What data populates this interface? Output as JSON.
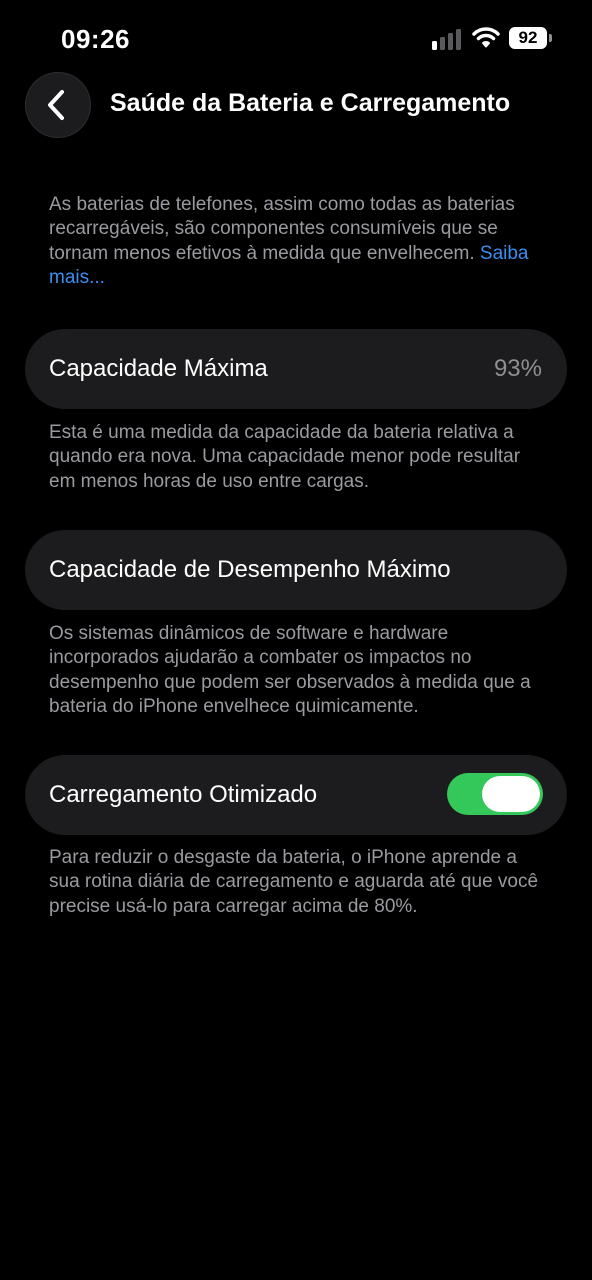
{
  "status_bar": {
    "time": "09:26",
    "battery_level": "92",
    "signal_bars_active": 1,
    "signal_bars_total": 4
  },
  "nav": {
    "back_icon": "chevron-left-icon",
    "title": "Saúde da Bateria e Carregamento"
  },
  "intro": {
    "text": "As baterias de telefones, assim como todas as baterias recarregáveis, são componentes consumíveis que se tornam menos efetivos à medida que envelhecem. ",
    "link": "Saiba mais..."
  },
  "max_capacity": {
    "label": "Capacidade Máxima",
    "value": "93%",
    "description": "Esta é uma medida da capacidade da bateria relativa a quando era nova. Uma capacidade menor pode resultar em menos horas de uso entre cargas."
  },
  "peak_performance": {
    "label": "Capacidade de Desempenho Máximo",
    "description": "Os sistemas dinâmicos de software e hardware incorporados ajudarão a combater os impactos no desempenho que podem ser observados à medida que a bateria do iPhone envelhece quimicamente."
  },
  "optimized_charging": {
    "label": "Carregamento Otimizado",
    "enabled": true,
    "description": "Para reduzir o desgaste da bateria, o iPhone aprende a sua rotina diária de carregamento e aguarda até que você precise usá-lo para carregar acima de 80%."
  },
  "colors": {
    "background": "#000000",
    "card": "#1c1c1e",
    "secondary_text": "#9a9aa0",
    "link": "#3b8ef0",
    "toggle_on": "#34c759"
  }
}
